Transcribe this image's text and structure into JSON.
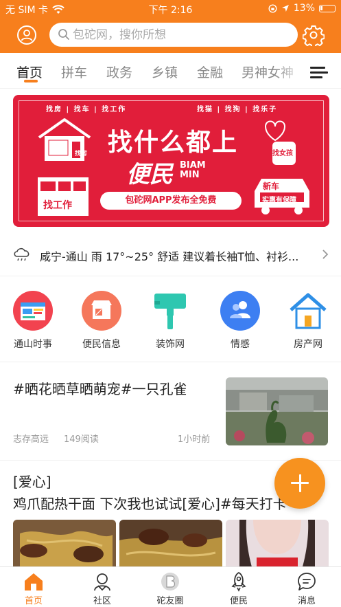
{
  "status_bar": {
    "carrier": "无 SIM 卡",
    "time": "下午 2:16",
    "battery": "13%"
  },
  "search": {
    "placeholder": "包砣网，搜你所想"
  },
  "tabs": [
    {
      "label": "首页",
      "active": true
    },
    {
      "label": "拼车"
    },
    {
      "label": "政务"
    },
    {
      "label": "乡镇"
    },
    {
      "label": "金融"
    },
    {
      "label": "男神女神"
    }
  ],
  "banner": {
    "top_left": "找房 | 找车 | 找工作",
    "top_right": "找猫 | 找狗 | 找乐子",
    "headline": "找什么都上",
    "sub": "便民",
    "sub_en_1": "BIAM",
    "sub_en_2": "MIN",
    "pill": "包砣网APP发布全免费",
    "left_tag": "找工作",
    "left_house": "找房",
    "right_car": "新车",
    "right_tag": "实惠有保障",
    "right_heart": "找女孩",
    "accent": "#e11e3a"
  },
  "weather": {
    "text": "咸宁-通山 雨 17°~25° 舒适 建议着长袖T恤、衬衫..."
  },
  "quick_links": [
    {
      "label": "通山时事",
      "icon": "news-icon"
    },
    {
      "label": "便民信息",
      "icon": "shop-icon"
    },
    {
      "label": "装饰网",
      "icon": "paint-roller-icon"
    },
    {
      "label": "情感",
      "icon": "people-icon"
    },
    {
      "label": "房产网",
      "icon": "house-icon"
    }
  ],
  "feed": [
    {
      "title": "#晒花晒草晒萌宠#一只孔雀",
      "author": "志存高远",
      "reads": "149阅读",
      "time": "1小时前"
    },
    {
      "title_line1": "[爱心]",
      "title_line2": "鸡爪配热干面 下次我也试试[爱心]#每天打卡"
    }
  ],
  "bottom_nav": [
    {
      "label": "首页",
      "icon": "home-icon",
      "active": true
    },
    {
      "label": "社区",
      "icon": "community-icon"
    },
    {
      "label": "砣友圈",
      "icon": "friends-circle-icon"
    },
    {
      "label": "便民",
      "icon": "rocket-icon"
    },
    {
      "label": "消息",
      "icon": "message-icon"
    }
  ],
  "colors": {
    "brand": "#f77f1d",
    "fab": "#f7921f"
  }
}
